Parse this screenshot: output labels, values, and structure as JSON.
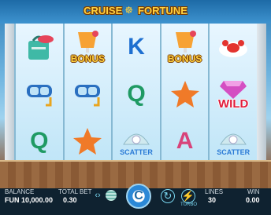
{
  "title": {
    "part1": "CRUISE",
    "part2": "FORTUNE"
  },
  "reels": [
    [
      {
        "type": "icon",
        "name": "beach-bag-icon"
      },
      {
        "type": "icon",
        "name": "diving-mask-icon"
      },
      {
        "type": "letter",
        "value": "Q"
      }
    ],
    [
      {
        "type": "icon",
        "name": "cocktail-icon",
        "label": "BONUS"
      },
      {
        "type": "icon",
        "name": "diving-mask-icon"
      },
      {
        "type": "icon",
        "name": "starfish-icon"
      }
    ],
    [
      {
        "type": "letter",
        "value": "K"
      },
      {
        "type": "letter",
        "value": "Q"
      },
      {
        "type": "icon",
        "name": "pearl-shell-icon",
        "label": "SCATTER"
      }
    ],
    [
      {
        "type": "icon",
        "name": "cocktail-icon",
        "label": "BONUS"
      },
      {
        "type": "icon",
        "name": "starfish-icon"
      },
      {
        "type": "letter",
        "value": "A"
      }
    ],
    [
      {
        "type": "icon",
        "name": "lobster-icon"
      },
      {
        "type": "icon",
        "name": "diamond-icon",
        "label": "WILD"
      },
      {
        "type": "icon",
        "name": "pearl-shell-icon",
        "label": "SCATTER"
      }
    ]
  ],
  "bottom": {
    "balance_label": "BALANCE",
    "balance_value": "FUN 10,000.00",
    "total_bet_label": "TOTAL BET",
    "total_bet_value": "0.30",
    "lines_label": "LINES",
    "lines_value": "30",
    "win_label": "WIN",
    "win_value": "0.00",
    "turbo_label": "TURBO"
  }
}
